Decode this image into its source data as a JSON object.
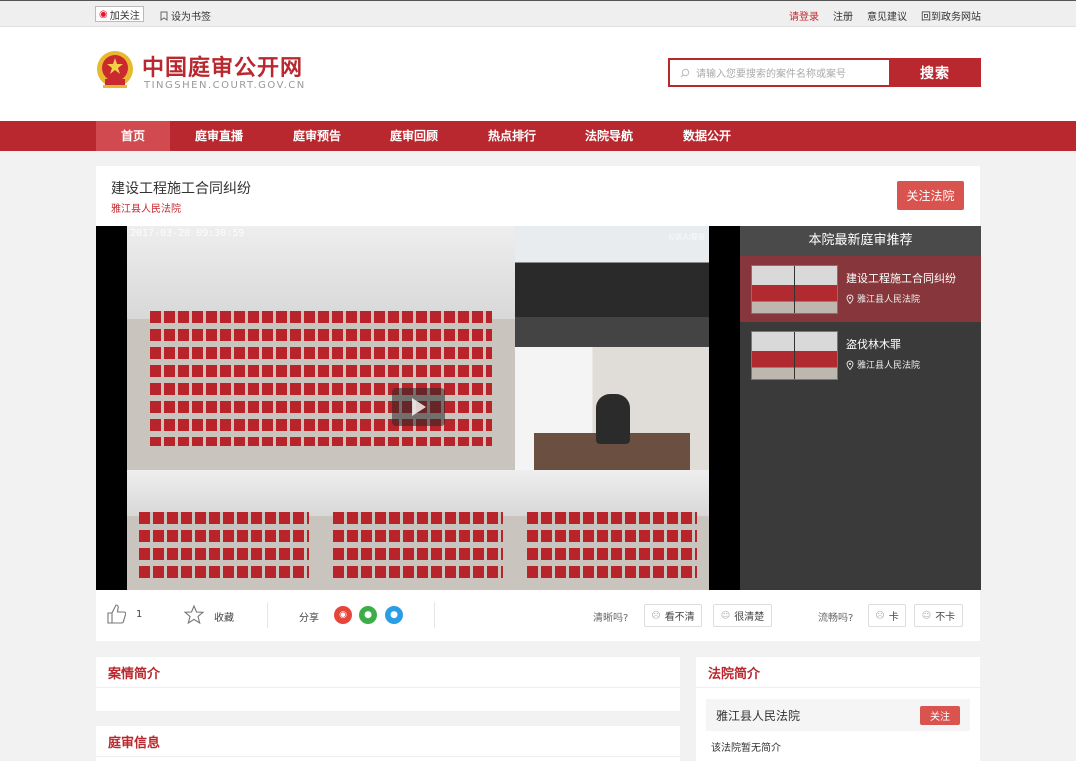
{
  "topbar": {
    "follow_label": "加关注",
    "bookmark_label": "设为书签",
    "links": [
      "请登录",
      "注册",
      "意见建议",
      "回到政务网站"
    ]
  },
  "header": {
    "site_title": "中国庭审公开网",
    "site_domain": "TINGSHEN.COURT.GOV.CN",
    "search_placeholder": "请输入您要搜索的案件名称或案号",
    "search_button": "搜索"
  },
  "nav": {
    "items": [
      "首页",
      "庭审直播",
      "庭审预告",
      "庭审回顾",
      "热点排行",
      "法院导航",
      "数据公开"
    ],
    "active_index": 0
  },
  "case": {
    "title": "建设工程施工合同纠纷",
    "court": "雅江县人民法院",
    "follow_button": "关注法院"
  },
  "video": {
    "timestamp": "2017-03-20 09:30:59",
    "watermark": "公诉人/原告"
  },
  "recommend": {
    "title": "本院最新庭审推荐",
    "items": [
      {
        "name": "建设工程施工合同纠纷",
        "court": "雅江县人民法院"
      },
      {
        "name": "盗伐林木罪",
        "court": "雅江县人民法院"
      }
    ]
  },
  "actions": {
    "like_count": "1",
    "collect_label": "收藏",
    "share_label": "分享",
    "clarity_question": "清晰吗?",
    "clarity_options": [
      "看不清",
      "很清楚"
    ],
    "fluency_question": "流畅吗?",
    "fluency_options": [
      "卡",
      "不卡"
    ]
  },
  "sections": {
    "case_summary_title": "案情简介",
    "trial_info_title": "庭审信息",
    "court_intro_title": "法院简介",
    "court_name": "雅江县人民法院",
    "court_follow_button": "关注",
    "court_description": "该法院暂无简介"
  },
  "colors": {
    "brand_red": "#b8282e",
    "nav_active": "#d04a4f",
    "button_red": "#d9534f",
    "rec_active": "#87373b",
    "rec_bg": "#3a3a3a"
  }
}
